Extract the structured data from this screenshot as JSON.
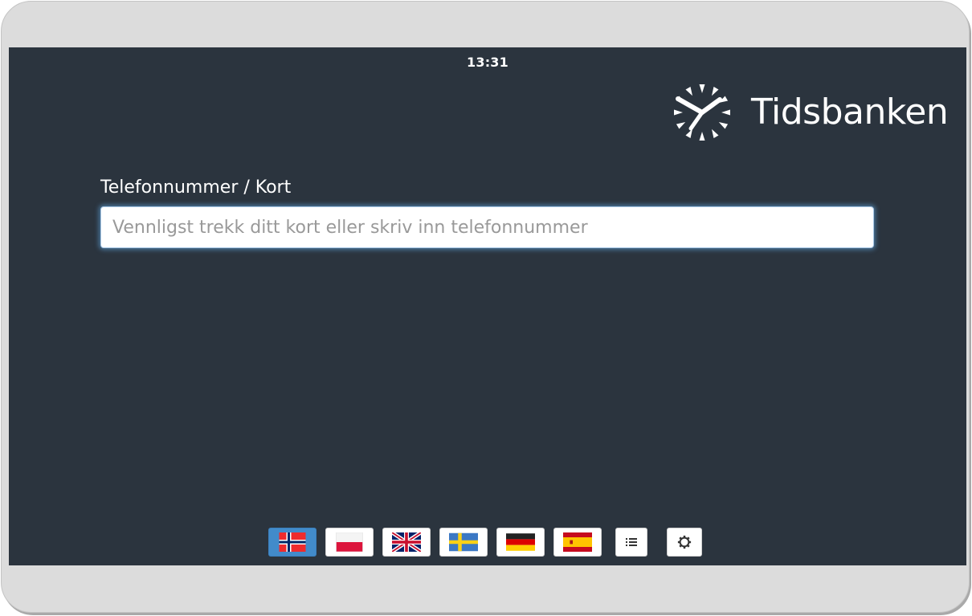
{
  "status_bar": {
    "time": "13:31"
  },
  "brand": {
    "name": "Tidsbanken",
    "icon": "tidsbanken-clock-logo"
  },
  "login_form": {
    "label": "Telefonnummer / Kort",
    "input_value": "",
    "input_placeholder": "Vennligst trekk ditt kort eller skriv inn telefonnummer"
  },
  "language_bar": {
    "selected": "norwegian",
    "languages": [
      {
        "id": "norwegian",
        "icon": "flag-norway-icon"
      },
      {
        "id": "polish",
        "icon": "flag-poland-icon"
      },
      {
        "id": "english",
        "icon": "flag-uk-icon"
      },
      {
        "id": "swedish",
        "icon": "flag-sweden-icon"
      },
      {
        "id": "german",
        "icon": "flag-germany-icon"
      },
      {
        "id": "spanish",
        "icon": "flag-spain-icon"
      }
    ],
    "extra_buttons": [
      {
        "id": "list",
        "icon": "list-icon"
      },
      {
        "id": "settings",
        "icon": "gear-icon"
      }
    ]
  },
  "colors": {
    "screen_background": "#2b343e",
    "device_bezel": "#dcdcdc",
    "active_button": "#428bca",
    "text": "#ffffff"
  }
}
